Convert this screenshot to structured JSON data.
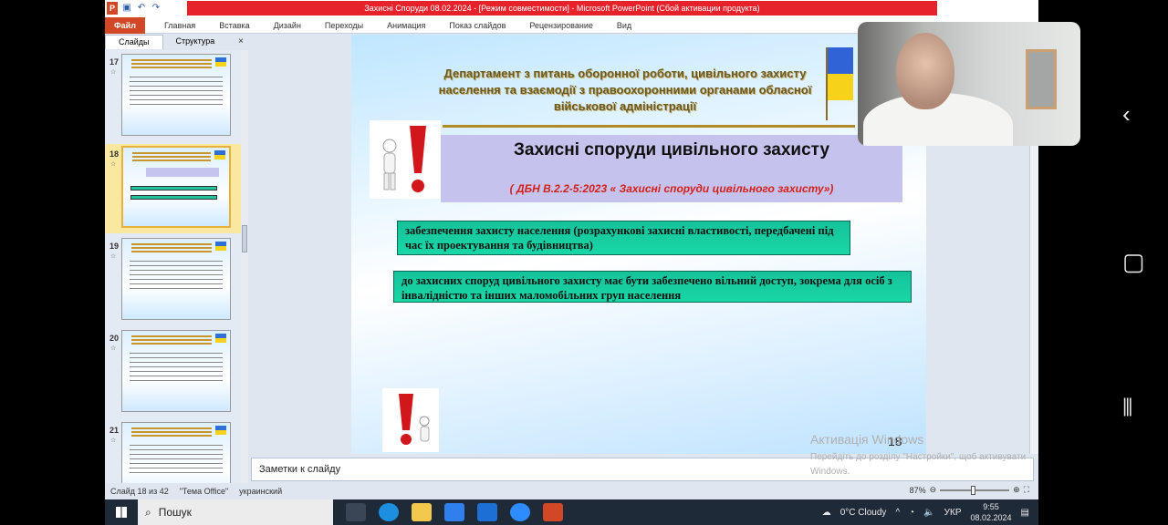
{
  "window": {
    "title": "Захисні Споруди 08.02.2024 - [Режим совместимости] - Microsoft PowerPoint (Сбой активации продукта)",
    "controls": [
      "—",
      "❐",
      "✕"
    ]
  },
  "ribbon": {
    "file": "Файл",
    "tabs": [
      "Главная",
      "Вставка",
      "Дизайн",
      "Переходы",
      "Анимация",
      "Показ слайдов",
      "Рецензирование",
      "Вид"
    ]
  },
  "panel": {
    "tabs": [
      "Слайды",
      "Структура"
    ],
    "close": "×",
    "thumbs": [
      {
        "num": "17"
      },
      {
        "num": "18"
      },
      {
        "num": "19"
      },
      {
        "num": "20"
      },
      {
        "num": "21"
      }
    ]
  },
  "slide": {
    "dept": "Департамент з питань оборонної роботи, цивільного захисту населення та взаємодії з правоохоронними органами обласної військової адміністрації",
    "title": "Захисні споруди цивільного захисту",
    "subtitle": "( ДБН В.2.2-5:2023 « Захисні споруди цивільного захисту»)",
    "box1": "забезпечення захисту населення (розрахункові захисні властивості, передбачені під час їх проектування та будівництва)",
    "box2": "до захисних споруд цивільного захисту має бути забезпечено вільний доступ, зокрема для осіб з інвалідністю та інших маломобільних груп населення",
    "number": "18"
  },
  "notes": {
    "placeholder": "Заметки к слайду"
  },
  "status": {
    "slide_info": "Слайд 18 из 42",
    "theme": "\"Тема Office\"",
    "lang": "украинский",
    "zoom": "87%"
  },
  "activation": {
    "title": "Активація Windows",
    "sub": "Перейдіть до розділу \"Настройки\", щоб активувати Windows."
  },
  "taskbar": {
    "search": "Пошук",
    "weather": "0°C Cloudy",
    "lang": "УКР",
    "time": "9:55",
    "date": "08.02.2024"
  },
  "colors": {
    "accent": "#d24726",
    "title_red": "#e8222b",
    "green_box": "#19d7a6",
    "title_box": "#c5c3ee"
  }
}
